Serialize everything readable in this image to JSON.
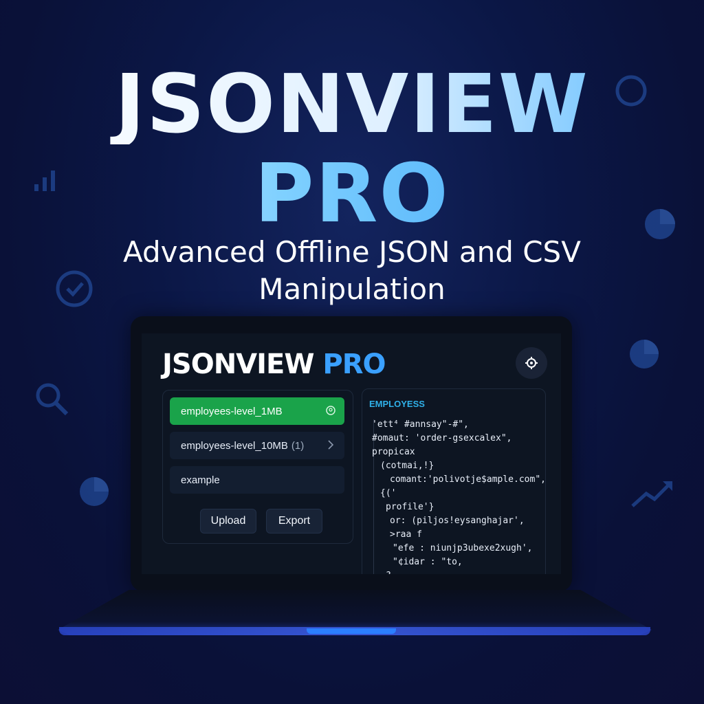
{
  "hero": {
    "title_line1": "JSONVIEW",
    "title_line2": "PRO",
    "subtitle_line1": "Advanced Offline JSON and CSV",
    "subtitle_line2": "Manipulation"
  },
  "app": {
    "title_main": "JSONVIEW",
    "title_accent": "PRO",
    "files": [
      {
        "name": "employees-level_1MB",
        "count": "",
        "state": "active"
      },
      {
        "name": "employees-level_10MB",
        "count": "(1)",
        "state": "normal"
      },
      {
        "name": "example",
        "count": "",
        "state": "normal"
      }
    ],
    "buttons": {
      "upload": "Upload",
      "export": "Export"
    },
    "preview": {
      "title": "EMPLOYESS",
      "lines": [
        "'ett⁴ #annsay\"-#\",",
        "#omaut: 'order-gsexcalex\",",
        "propicax",
        "(cotmai,!}",
        "comant:'polivotje$ample.com\",",
        "{('",
        "profile'}",
        "or: (piljos!eysanghajar',",
        ">raa f",
        "\"efe : niunjp3ubexe2xugh',",
        "\"¢idar : \"to,",
        "?,"
      ]
    }
  },
  "colors": {
    "accent_blue": "#3aa0ff",
    "active_green": "#1aa34a",
    "preview_title": "#2fb0e8",
    "background": "#0b1746"
  },
  "icons": [
    "bar-chart-icon",
    "circle-icon",
    "pie-chart-icon",
    "gauge-icon",
    "search-icon",
    "trend-up-icon",
    "settings-icon",
    "file-badge-icon",
    "chevron-right-icon"
  ]
}
